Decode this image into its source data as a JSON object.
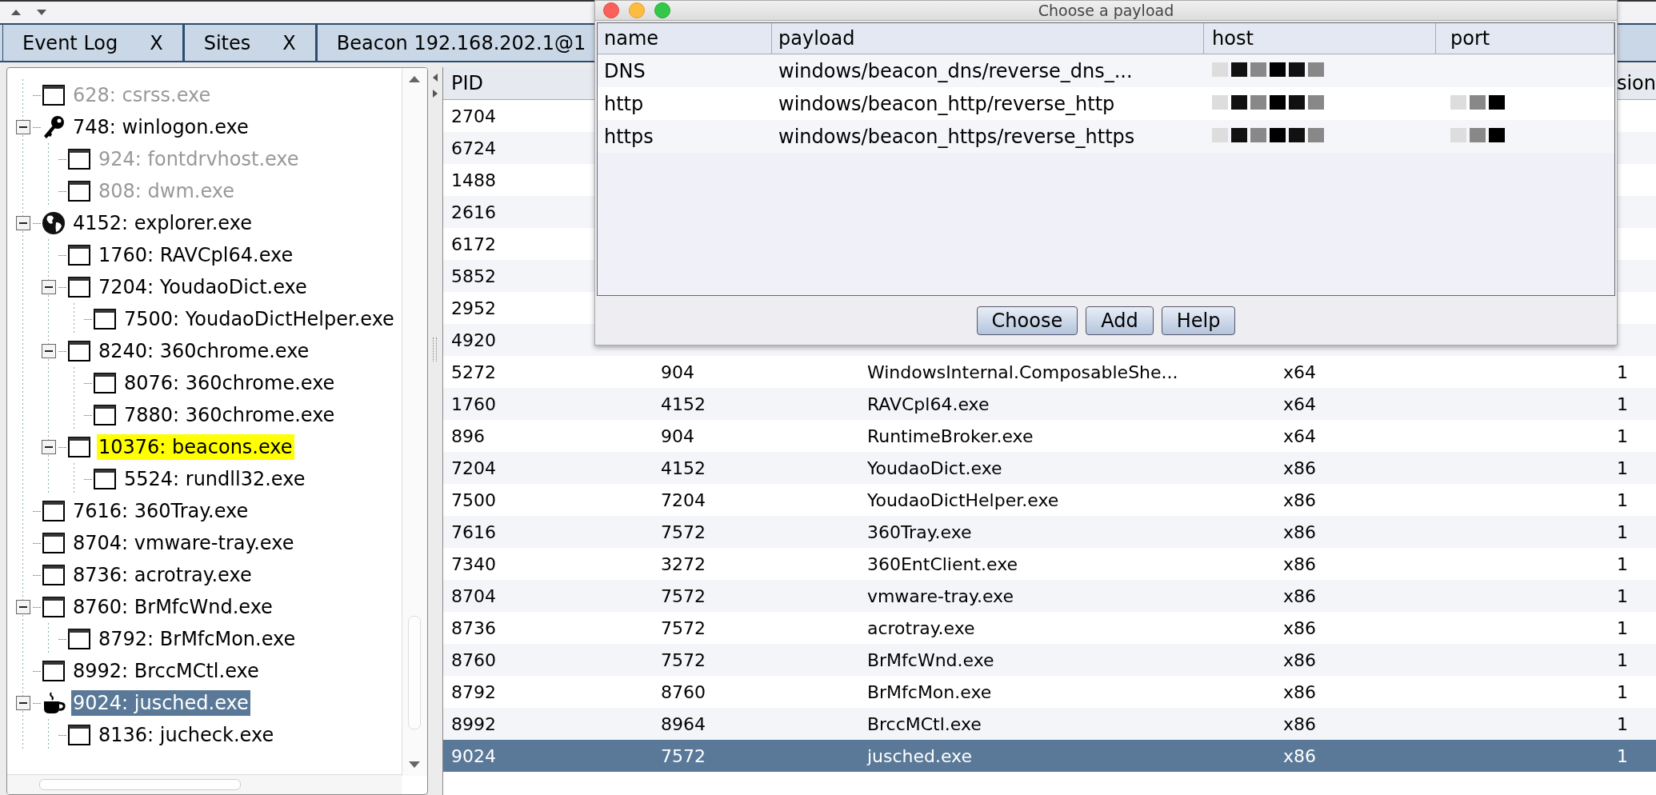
{
  "tabs": [
    {
      "label": "Event Log",
      "close": "X"
    },
    {
      "label": "Sites",
      "close": "X"
    },
    {
      "label": "Beacon 192.168.202.1@1"
    }
  ],
  "process_tree": {
    "items": [
      {
        "label": "628: csrss.exe",
        "kind": "window",
        "dimmed": true,
        "highlighted": false,
        "selected": false
      },
      {
        "label": "748: winlogon.exe",
        "kind": "key",
        "dimmed": false,
        "highlighted": false,
        "selected": false,
        "expanded": true,
        "children": [
          {
            "label": "924: fontdrvhost.exe",
            "kind": "window",
            "dimmed": true,
            "highlighted": false,
            "selected": false
          },
          {
            "label": "808: dwm.exe",
            "kind": "window",
            "dimmed": true,
            "highlighted": false,
            "selected": false
          }
        ]
      },
      {
        "label": "4152: explorer.exe",
        "kind": "globe",
        "dimmed": false,
        "highlighted": false,
        "selected": false,
        "expanded": true,
        "children": [
          {
            "label": "1760: RAVCpl64.exe",
            "kind": "window",
            "dimmed": false,
            "highlighted": false,
            "selected": false
          },
          {
            "label": "7204: YoudaoDict.exe",
            "kind": "window",
            "dimmed": false,
            "highlighted": false,
            "selected": false,
            "expanded": true,
            "children": [
              {
                "label": "7500: YoudaoDictHelper.exe",
                "kind": "window",
                "dimmed": false,
                "highlighted": false,
                "selected": false
              }
            ]
          },
          {
            "label": "8240: 360chrome.exe",
            "kind": "window",
            "dimmed": false,
            "highlighted": false,
            "selected": false,
            "expanded": true,
            "children": [
              {
                "label": "8076: 360chrome.exe",
                "kind": "window",
                "dimmed": false,
                "highlighted": false,
                "selected": false
              },
              {
                "label": "7880: 360chrome.exe",
                "kind": "window",
                "dimmed": false,
                "highlighted": false,
                "selected": false
              }
            ]
          },
          {
            "label": "10376: beacons.exe",
            "kind": "window",
            "dimmed": false,
            "highlighted": true,
            "selected": false,
            "expanded": true,
            "children": [
              {
                "label": "5524: rundll32.exe",
                "kind": "window",
                "dimmed": false,
                "highlighted": false,
                "selected": false
              }
            ]
          }
        ]
      },
      {
        "label": "7616: 360Tray.exe",
        "kind": "window",
        "dimmed": false,
        "highlighted": false,
        "selected": false
      },
      {
        "label": "8704: vmware-tray.exe",
        "kind": "window",
        "dimmed": false,
        "highlighted": false,
        "selected": false
      },
      {
        "label": "8736: acrotray.exe",
        "kind": "window",
        "dimmed": false,
        "highlighted": false,
        "selected": false
      },
      {
        "label": "8760: BrMfcWnd.exe",
        "kind": "window",
        "dimmed": false,
        "highlighted": false,
        "selected": false,
        "expanded": true,
        "children": [
          {
            "label": "8792: BrMfcMon.exe",
            "kind": "window",
            "dimmed": false,
            "highlighted": false,
            "selected": false
          }
        ]
      },
      {
        "label": "8992: BrccMCtl.exe",
        "kind": "window",
        "dimmed": false,
        "highlighted": false,
        "selected": false
      },
      {
        "label": "9024: jusched.exe",
        "kind": "cup",
        "dimmed": false,
        "highlighted": false,
        "selected": true,
        "expanded": true,
        "children": [
          {
            "label": "8136: jucheck.exe",
            "kind": "window",
            "dimmed": false,
            "highlighted": false,
            "selected": false
          }
        ]
      }
    ]
  },
  "process_table": {
    "header": {
      "column_1": "PID",
      "column_5": "sion"
    },
    "rows": [
      {
        "pid": "2704",
        "selected": false
      },
      {
        "pid": "6724",
        "selected": false
      },
      {
        "pid": "1488",
        "selected": false
      },
      {
        "pid": "2616",
        "selected": false
      },
      {
        "pid": "6172",
        "selected": false
      },
      {
        "pid": "5852",
        "selected": false
      },
      {
        "pid": "2952",
        "selected": false
      },
      {
        "pid": "4920",
        "selected": false
      },
      {
        "pid": "5272",
        "ppid": "904",
        "name": "WindowsInternal.ComposableShe...",
        "arch": "x64",
        "session": "1",
        "selected": false
      },
      {
        "pid": "1760",
        "ppid": "4152",
        "name": "RAVCpl64.exe",
        "arch": "x64",
        "session": "1",
        "selected": false
      },
      {
        "pid": "896",
        "ppid": "904",
        "name": "RuntimeBroker.exe",
        "arch": "x64",
        "session": "1",
        "selected": false
      },
      {
        "pid": "7204",
        "ppid": "4152",
        "name": "YoudaoDict.exe",
        "arch": "x86",
        "session": "1",
        "selected": false
      },
      {
        "pid": "7500",
        "ppid": "7204",
        "name": "YoudaoDictHelper.exe",
        "arch": "x86",
        "session": "1",
        "selected": false
      },
      {
        "pid": "7616",
        "ppid": "7572",
        "name": "360Tray.exe",
        "arch": "x86",
        "session": "1",
        "selected": false
      },
      {
        "pid": "7340",
        "ppid": "3272",
        "name": "360EntClient.exe",
        "arch": "x86",
        "session": "1",
        "selected": false
      },
      {
        "pid": "8704",
        "ppid": "7572",
        "name": "vmware-tray.exe",
        "arch": "x86",
        "session": "1",
        "selected": false
      },
      {
        "pid": "8736",
        "ppid": "7572",
        "name": "acrotray.exe",
        "arch": "x86",
        "session": "1",
        "selected": false
      },
      {
        "pid": "8760",
        "ppid": "7572",
        "name": "BrMfcWnd.exe",
        "arch": "x86",
        "session": "1",
        "selected": false
      },
      {
        "pid": "8792",
        "ppid": "8760",
        "name": "BrMfcMon.exe",
        "arch": "x86",
        "session": "1",
        "selected": false
      },
      {
        "pid": "8992",
        "ppid": "8964",
        "name": "BrccMCtl.exe",
        "arch": "x86",
        "session": "1",
        "selected": false
      },
      {
        "pid": "9024",
        "ppid": "7572",
        "name": "jusched.exe",
        "arch": "x86",
        "session": "1",
        "selected": true
      }
    ]
  },
  "dialog": {
    "title": "Choose a payload",
    "columns": [
      "name",
      "payload",
      "host",
      "port"
    ],
    "rows": [
      {
        "name": "DNS",
        "payload": "windows/beacon_dns/reverse_dns_...",
        "host_redacted": true,
        "port_redacted": false
      },
      {
        "name": "http",
        "payload": "windows/beacon_http/reverse_http",
        "host_redacted": true,
        "port_redacted": true
      },
      {
        "name": "https",
        "payload": "windows/beacon_https/reverse_https",
        "host_redacted": true,
        "port_redacted": true
      }
    ],
    "buttons": [
      "Choose",
      "Add",
      "Help"
    ]
  }
}
